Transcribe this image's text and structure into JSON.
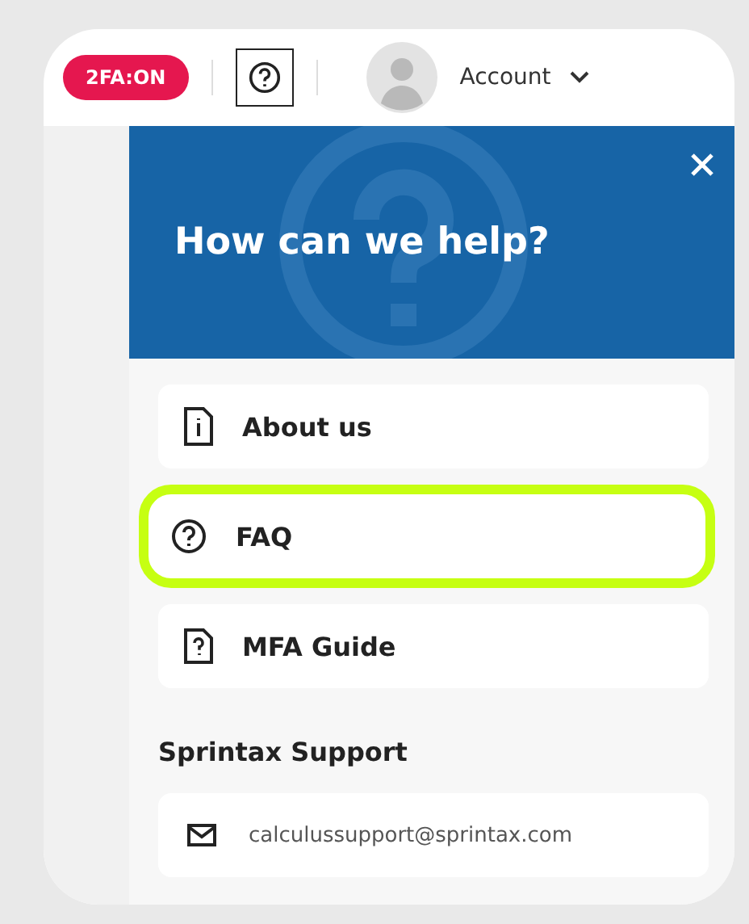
{
  "header": {
    "badge": "2FA:ON",
    "account": "Account"
  },
  "help_panel": {
    "title": "How can we help?",
    "items": [
      {
        "kind": "info",
        "label": "About us",
        "selected": false
      },
      {
        "kind": "question",
        "label": "FAQ",
        "selected": true
      },
      {
        "kind": "guide",
        "label": "MFA Guide",
        "selected": false
      }
    ],
    "support_heading": "Sprintax Support",
    "email": "calculussupport@sprintax.com"
  }
}
